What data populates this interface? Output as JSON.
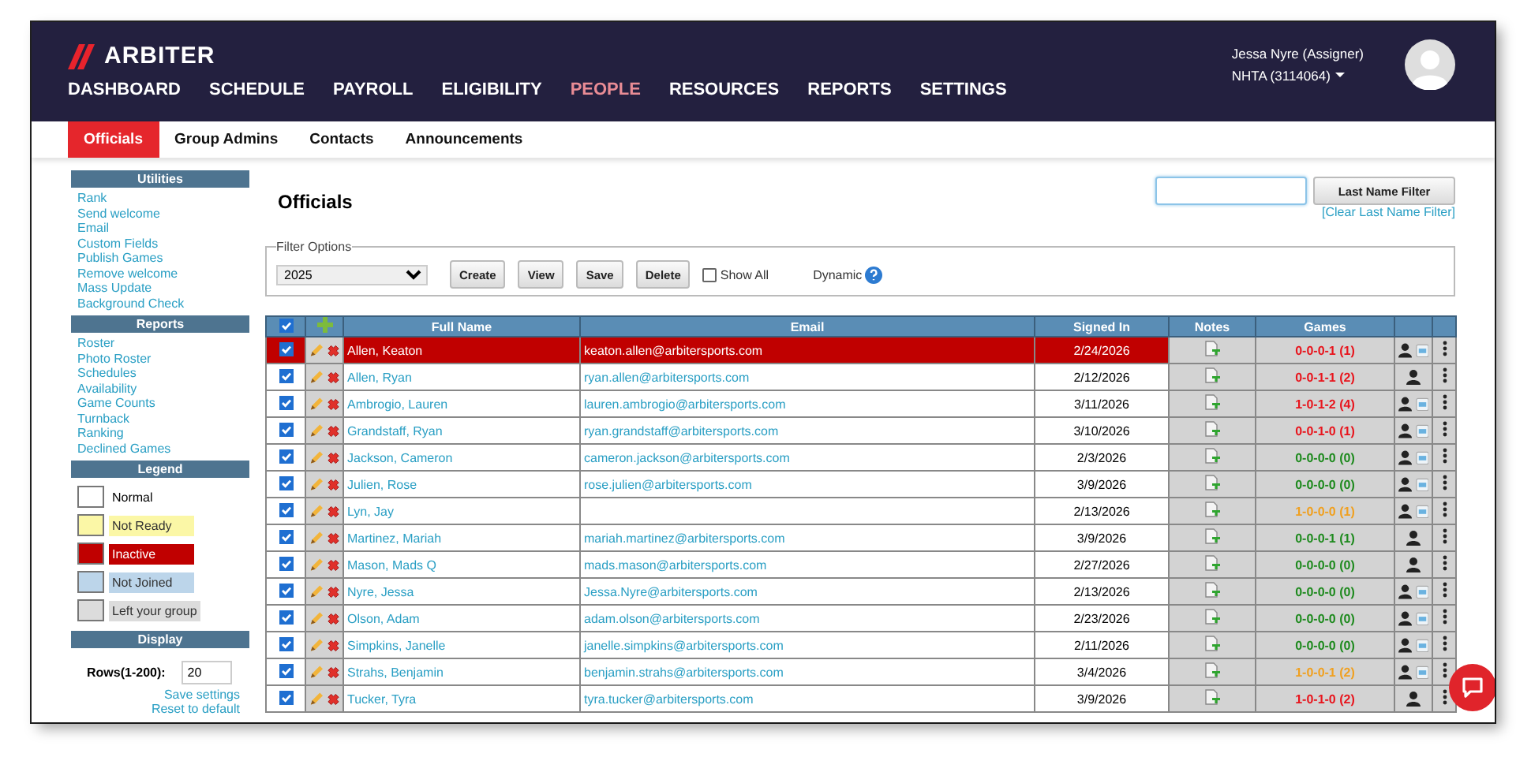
{
  "header": {
    "logo": "ARBITER",
    "user": "Jessa Nyre (Assigner)",
    "group": "NHTA (3114064)",
    "nav": [
      {
        "label": "DASHBOARD",
        "selected": false
      },
      {
        "label": "SCHEDULE",
        "selected": false
      },
      {
        "label": "PAYROLL",
        "selected": false
      },
      {
        "label": "ELIGIBILITY",
        "selected": false
      },
      {
        "label": "PEOPLE",
        "selected": true
      },
      {
        "label": "RESOURCES",
        "selected": false
      },
      {
        "label": "REPORTS",
        "selected": false
      },
      {
        "label": "SETTINGS",
        "selected": false
      }
    ]
  },
  "subtabs": [
    {
      "label": "Officials",
      "selected": true
    },
    {
      "label": "Group Admins",
      "selected": false
    },
    {
      "label": "Contacts",
      "selected": false
    },
    {
      "label": "Announcements",
      "selected": false
    }
  ],
  "sidebar": {
    "utilities": {
      "title": "Utilities",
      "links": [
        "Rank",
        "Send welcome",
        "Email",
        "Custom Fields",
        "Publish Games",
        "Remove welcome",
        "Mass Update",
        "Background Check"
      ]
    },
    "reports": {
      "title": "Reports",
      "links": [
        "Roster",
        "Photo Roster",
        "Schedules",
        "Availability",
        "Game Counts",
        "Turnback",
        "Ranking",
        "Declined Games"
      ]
    },
    "legend": {
      "title": "Legend",
      "items": [
        {
          "label": "Normal",
          "color": "#ffffff"
        },
        {
          "label": "Not Ready",
          "color": "#fbf7a6"
        },
        {
          "label": "Inactive",
          "color": "#c00000"
        },
        {
          "label": "Not Joined",
          "color": "#bcd5ea"
        },
        {
          "label": "Left your group",
          "color": "#dcdcdc"
        }
      ]
    },
    "display": {
      "title": "Display",
      "rows_label": "Rows(1-200):",
      "rows_value": "20",
      "links": [
        "Save settings",
        "Reset to default"
      ]
    }
  },
  "main": {
    "title": "Officials",
    "search_button": "Last Name Filter",
    "clear_link": "[Clear Last Name Filter]",
    "filter": {
      "legend": "Filter Options",
      "select": "2025",
      "buttons": [
        "Create",
        "View",
        "Save",
        "Delete"
      ],
      "show_all": {
        "label": "Show All",
        "checked": false
      },
      "dynamic": "Dynamic"
    },
    "select_all_checked": true,
    "columns": [
      "Full Name",
      "Email",
      "Signed In",
      "Notes",
      "Games"
    ],
    "rows": [
      {
        "checked": true,
        "inactive": true,
        "name": "Allen, Keaton",
        "email": "keaton.allen@arbitersports.com",
        "signed_in": "2/24/2026",
        "games": {
          "text": "0-0-0-1 (1)",
          "color": "#e8141c"
        },
        "calendar": true
      },
      {
        "checked": true,
        "inactive": false,
        "name": "Allen, Ryan",
        "email": "ryan.allen@arbitersports.com",
        "signed_in": "2/12/2026",
        "games": {
          "text": "0-0-1-1 (2)",
          "color": "#e8141c"
        },
        "calendar": false
      },
      {
        "checked": true,
        "inactive": false,
        "name": "Ambrogio, Lauren",
        "email": "lauren.ambrogio@arbitersports.com",
        "signed_in": "3/11/2026",
        "games": {
          "text": "1-0-1-2 (4)",
          "color": "#e8141c"
        },
        "calendar": true
      },
      {
        "checked": true,
        "inactive": false,
        "name": "Grandstaff, Ryan",
        "email": "ryan.grandstaff@arbitersports.com",
        "signed_in": "3/10/2026",
        "games": {
          "text": "0-0-1-0 (1)",
          "color": "#e8141c"
        },
        "calendar": true
      },
      {
        "checked": true,
        "inactive": false,
        "name": "Jackson, Cameron",
        "email": "cameron.jackson@arbitersports.com",
        "signed_in": "2/3/2026",
        "games": {
          "text": "0-0-0-0 (0)",
          "color": "#1e8a1e"
        },
        "calendar": true
      },
      {
        "checked": true,
        "inactive": false,
        "name": "Julien, Rose",
        "email": "rose.julien@arbitersports.com",
        "signed_in": "3/9/2026",
        "games": {
          "text": "0-0-0-0 (0)",
          "color": "#1e8a1e"
        },
        "calendar": true
      },
      {
        "checked": true,
        "inactive": false,
        "name": "Lyn, Jay",
        "signed_in": "2/13/2026",
        "games": {
          "text": "1-0-0-0 (1)",
          "color": "#f0a020"
        },
        "calendar": true
      },
      {
        "checked": true,
        "inactive": false,
        "name": "Martinez, Mariah",
        "email": "mariah.martinez@arbitersports.com",
        "signed_in": "3/9/2026",
        "games": {
          "text": "0-0-0-1 (1)",
          "color": "#1e8a1e"
        },
        "calendar": false
      },
      {
        "checked": true,
        "inactive": false,
        "name": "Mason, Mads Q",
        "email": "mads.mason@arbitersports.com",
        "signed_in": "2/27/2026",
        "games": {
          "text": "0-0-0-0 (0)",
          "color": "#1e8a1e"
        },
        "calendar": false
      },
      {
        "checked": true,
        "inactive": false,
        "name": "Nyre, Jessa",
        "email": "Jessa.Nyre@arbitersports.com",
        "signed_in": "2/13/2026",
        "games": {
          "text": "0-0-0-0 (0)",
          "color": "#1e8a1e"
        },
        "calendar": true
      },
      {
        "checked": true,
        "inactive": false,
        "name": "Olson, Adam",
        "email": "adam.olson@arbitersports.com",
        "signed_in": "2/23/2026",
        "games": {
          "text": "0-0-0-0 (0)",
          "color": "#1e8a1e"
        },
        "calendar": true
      },
      {
        "checked": true,
        "inactive": false,
        "name": "Simpkins, Janelle",
        "email": "janelle.simpkins@arbitersports.com",
        "signed_in": "2/11/2026",
        "games": {
          "text": "0-0-0-0 (0)",
          "color": "#1e8a1e"
        },
        "calendar": true
      },
      {
        "checked": true,
        "inactive": false,
        "name": "Strahs, Benjamin",
        "email": "benjamin.strahs@arbitersports.com",
        "signed_in": "3/4/2026",
        "games": {
          "text": "1-0-0-1 (2)",
          "color": "#f0a020"
        },
        "calendar": true
      },
      {
        "checked": true,
        "inactive": false,
        "name": "Tucker, Tyra",
        "email": "tyra.tucker@arbitersports.com",
        "signed_in": "3/9/2026",
        "games": {
          "text": "1-0-1-0 (2)",
          "color": "#e8141c"
        },
        "calendar": false
      }
    ]
  }
}
